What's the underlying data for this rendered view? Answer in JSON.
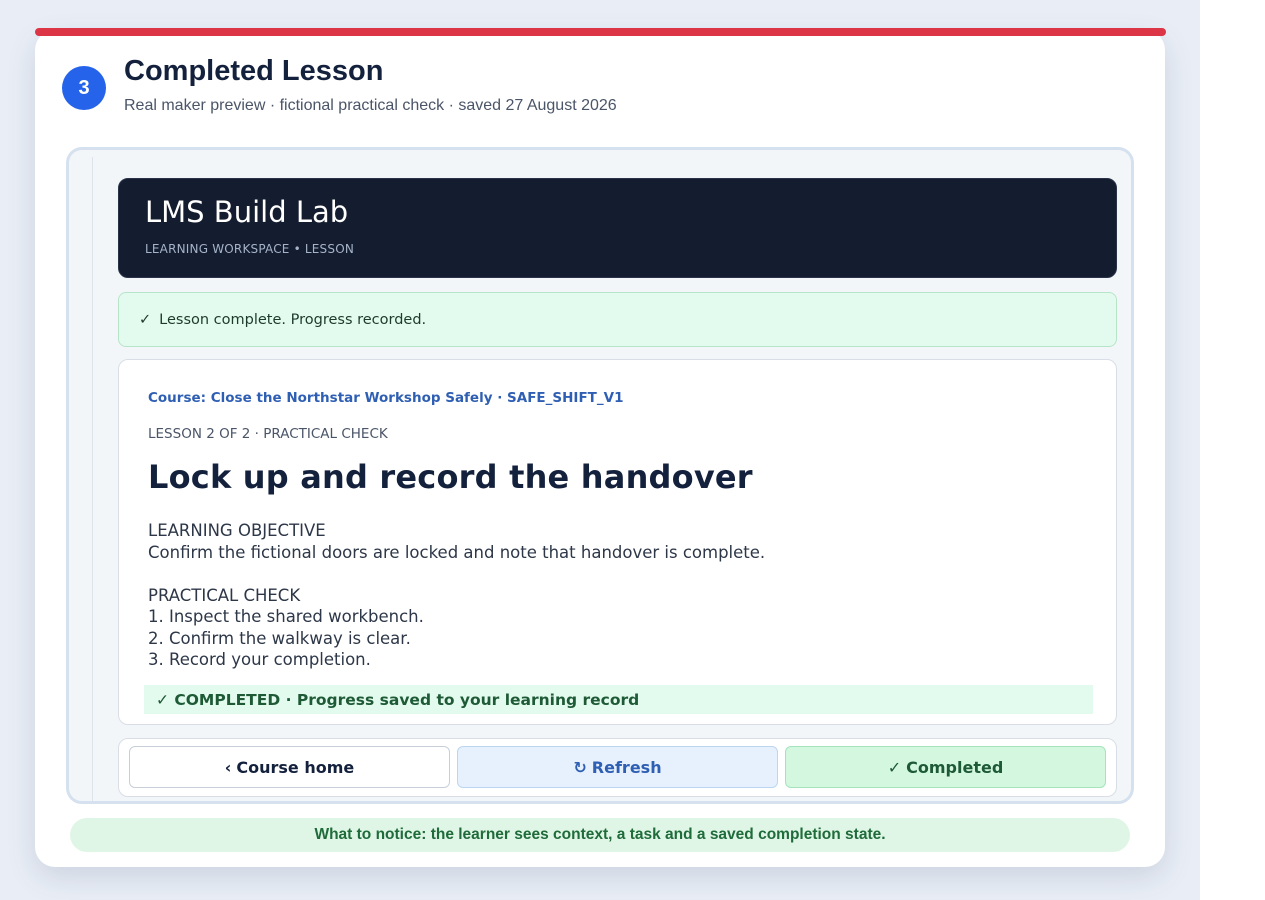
{
  "step": {
    "number": "3"
  },
  "card": {
    "title": "Completed Lesson",
    "subtitle": "Real maker preview · fictional practical check · saved 27 August 2026"
  },
  "lms": {
    "title": "LMS Build Lab",
    "breadcrumb": "LEARNING WORKSPACE • LESSON"
  },
  "alert": {
    "icon": "check-icon",
    "check": "✓",
    "text": "Lesson complete. Progress recorded."
  },
  "lesson": {
    "course": "Course: Close the Northstar Workshop Safely · SAFE_SHIFT_V1",
    "meta": "LESSON 2 OF 2 · PRACTICAL CHECK",
    "title": "Lock up and record the handover",
    "objective_heading": "LEARNING OBJECTIVE",
    "objective_text": "Confirm the fictional doors are locked and note that handover is complete.",
    "check_heading": "PRACTICAL CHECK",
    "steps": [
      "1. Inspect the shared workbench.",
      "2. Confirm the walkway is clear.",
      "3. Record your completion."
    ],
    "status": "✓ COMPLETED · Progress saved to your learning record"
  },
  "buttons": {
    "home": {
      "glyph": "‹",
      "label": "Course home",
      "icon": "chevron-left-icon"
    },
    "refresh": {
      "glyph": "↻",
      "label": "Refresh",
      "icon": "refresh-icon"
    },
    "completed": {
      "glyph": "✓",
      "label": "Completed",
      "icon": "check-icon"
    }
  },
  "notice": "What to notice: the learner sees context, a task and a saved completion state.",
  "colors": {
    "accent_bar": "#dc3545",
    "step_badge": "#2563eb",
    "header_bg": "#141c2f",
    "success_bg": "#e3fbee",
    "link_blue": "#2f5fb3"
  }
}
